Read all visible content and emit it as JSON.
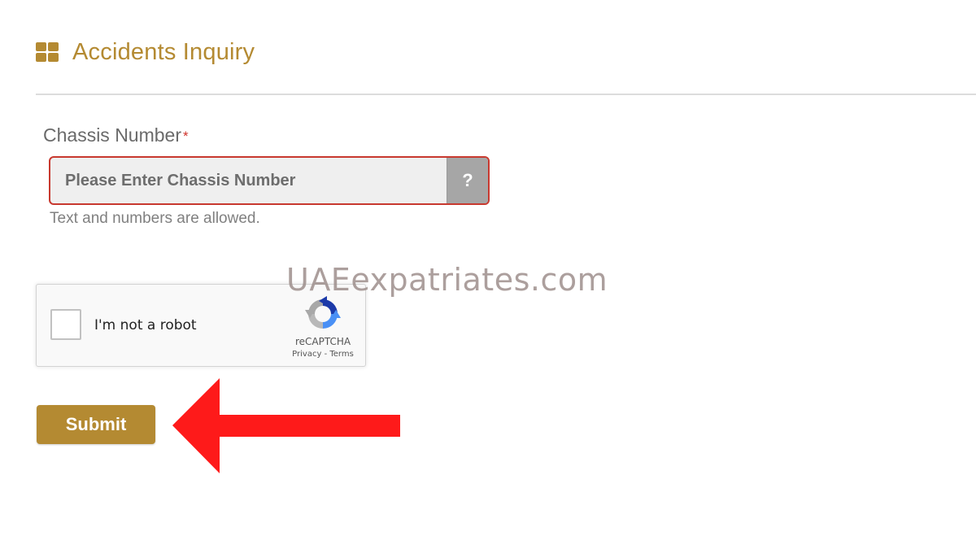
{
  "header": {
    "title": "Accidents Inquiry",
    "icon": "grid-icon"
  },
  "form": {
    "chassis": {
      "label": "Chassis Number",
      "required_mark": "*",
      "placeholder": "Please Enter Chassis Number",
      "value": "",
      "help_label": "?",
      "hint": "Text and numbers are allowed."
    },
    "recaptcha": {
      "label": "I'm not a robot",
      "brand": "reCAPTCHA",
      "privacy": "Privacy",
      "separator": " - ",
      "terms": "Terms",
      "checked": false
    },
    "submit_label": "Submit"
  },
  "watermark": "UAEexpatriates.com",
  "colors": {
    "accent": "#b48a32",
    "error_border": "#c8392f",
    "required": "#d0342c",
    "annotation_arrow": "#fe1a1a"
  }
}
